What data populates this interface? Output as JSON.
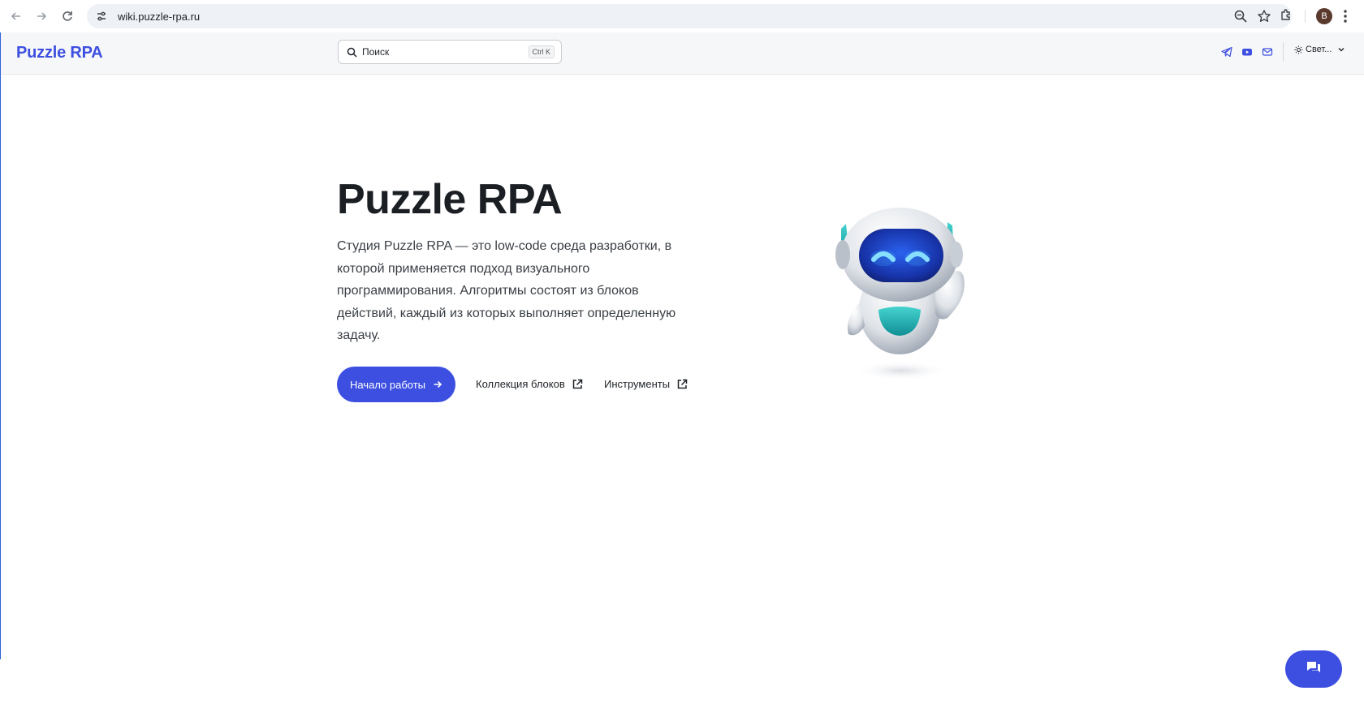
{
  "browser": {
    "url": "wiki.puzzle-rpa.ru",
    "avatar_letter": "B"
  },
  "navbar": {
    "brand": "Puzzle RPA",
    "search_placeholder": "Поиск",
    "search_shortcut": "Ctrl K",
    "theme_label": "Свет...",
    "social_icons": [
      "telegram-icon",
      "youtube-icon",
      "mail-icon"
    ]
  },
  "hero": {
    "title": "Puzzle RPA",
    "description": "Студия Puzzle RPA — это low-code среда разработки, в которой применяется подход визуального программирования. Алгоритмы состоят из блоков действий, каждый из которых выполняет определенную задачу.",
    "cta_label": "Начало работы",
    "link_blocks": "Коллекция блоков",
    "link_tools": "Инструменты"
  },
  "colors": {
    "accent": "#3d4fe0",
    "robot_visor": "#1e3fbf",
    "robot_teal": "#1fb5b3"
  }
}
